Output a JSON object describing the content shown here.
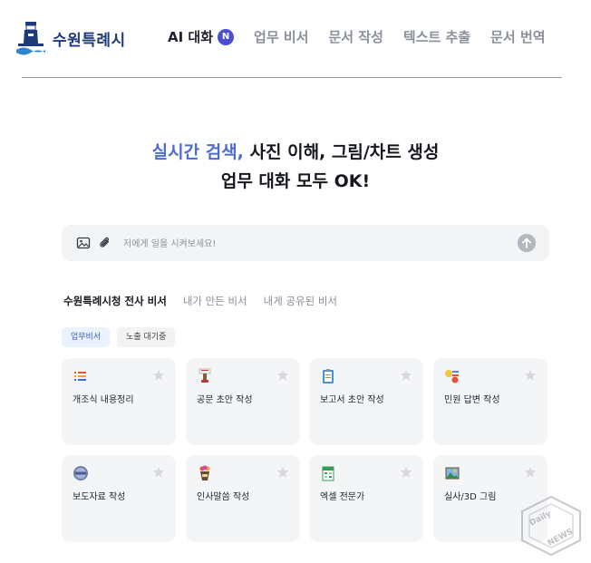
{
  "header": {
    "logo_text": "수원특례시",
    "nav": [
      {
        "label": "AI 대화",
        "badge": "N",
        "active": true
      },
      {
        "label": "업무 비서"
      },
      {
        "label": "문서 작성"
      },
      {
        "label": "텍스트 추출"
      },
      {
        "label": "문서 번역"
      }
    ]
  },
  "hero": {
    "accent": "실시간 검색,",
    "line1_rest": " 사진 이해, 그림/차트 생성",
    "line2": "업무 대화 모두 OK!"
  },
  "prompt": {
    "placeholder": "저에게 일을 시켜보세요!"
  },
  "tabs": [
    "수원특례시청 전사 비서",
    "내가 만든 비서",
    "내게 공유된 비서"
  ],
  "chips": [
    "업무비서",
    "노출 대기중"
  ],
  "cards": [
    {
      "title": "개조식 내용정리",
      "icon": "list-icon"
    },
    {
      "title": "공문 초안 작성",
      "icon": "stamp-icon"
    },
    {
      "title": "보고서 초안 작성",
      "icon": "clipboard-icon"
    },
    {
      "title": "민원 답변 작성",
      "icon": "message-icon"
    },
    {
      "title": "보도자료 작성",
      "icon": "news-icon"
    },
    {
      "title": "인사말씀 작성",
      "icon": "bouquet-icon"
    },
    {
      "title": "엑셀 전문가",
      "icon": "spreadsheet-icon"
    },
    {
      "title": "실사/3D 그림",
      "icon": "picture-icon"
    }
  ],
  "watermark": "Daily NEWS",
  "colors": {
    "accent": "#4e6bd0",
    "badge": "#4a4fd1",
    "chip_active_bg": "#eaf1ff",
    "card_bg": "#f4f5f7"
  }
}
